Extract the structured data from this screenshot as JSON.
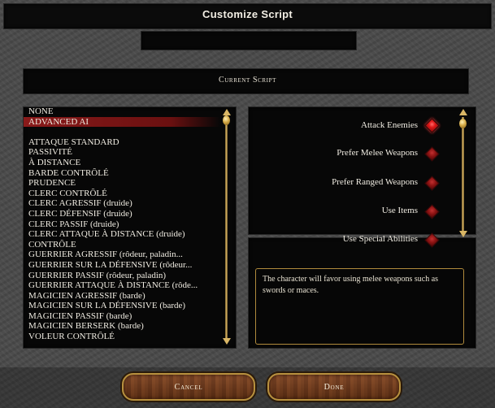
{
  "dialog": {
    "title": "Customize Script"
  },
  "current_script": {
    "label": "Current Script"
  },
  "script_list": {
    "items": [
      {
        "label": "NONE",
        "selected": false
      },
      {
        "label": "ADVANCED AI",
        "selected": true
      },
      {
        "label": "",
        "selected": false
      },
      {
        "label": "ATTAQUE STANDARD",
        "selected": false
      },
      {
        "label": "PASSIVITÉ",
        "selected": false
      },
      {
        "label": "À DISTANCE",
        "selected": false
      },
      {
        "label": "BARDE CONTRÔLÉ",
        "selected": false
      },
      {
        "label": "PRUDENCE",
        "selected": false
      },
      {
        "label": "CLERC CONTRÔLÉ",
        "selected": false
      },
      {
        "label": "CLERC AGRESSIF (druide)",
        "selected": false
      },
      {
        "label": "CLERC DÉFENSIF (druide)",
        "selected": false
      },
      {
        "label": "CLERC PASSIF (druide)",
        "selected": false
      },
      {
        "label": "CLERC ATTAQUE À DISTANCE (druide)",
        "selected": false
      },
      {
        "label": "CONTRÔLE",
        "selected": false
      },
      {
        "label": "GUERRIER AGRESSIF (rôdeur, paladin...",
        "selected": false
      },
      {
        "label": "GUERRIER SUR LA DÉFENSIVE (rôdeur...",
        "selected": false
      },
      {
        "label": "GUERRIER PASSIF (rôdeur, paladin)",
        "selected": false
      },
      {
        "label": "GUERRIER ATTAQUE À DISTANCE (rôde...",
        "selected": false
      },
      {
        "label": "MAGICIEN AGRESSIF (barde)",
        "selected": false
      },
      {
        "label": "MAGICIEN SUR LA DÉFENSIVE (barde)",
        "selected": false
      },
      {
        "label": "MAGICIEN PASSIF (barde)",
        "selected": false
      },
      {
        "label": "MAGICIEN BERSERK (barde)",
        "selected": false
      },
      {
        "label": "VOLEUR CONTRÔLÉ",
        "selected": false
      }
    ]
  },
  "options": [
    {
      "label": "Attack Enemies",
      "state": "on"
    },
    {
      "label": "Prefer Melee Weapons",
      "state": "off"
    },
    {
      "label": "Prefer Ranged Weapons",
      "state": "off"
    },
    {
      "label": "Use Items",
      "state": "off"
    },
    {
      "label": "Use Special Abilities",
      "state": "off"
    }
  ],
  "description": {
    "text": "The character will favor using melee weapons such as swords or maces."
  },
  "buttons": {
    "cancel": "Cancel",
    "done": "Done"
  },
  "colors": {
    "selection": "#8a1a1a",
    "gold": "#d9b665",
    "gem_on": "#e01818"
  },
  "icons": {
    "scroll_up": "arrow-up-icon",
    "scroll_down": "arrow-down-icon",
    "scroll_thumb": "scroll-knob-icon",
    "toggle": "ruby-gem-icon"
  }
}
